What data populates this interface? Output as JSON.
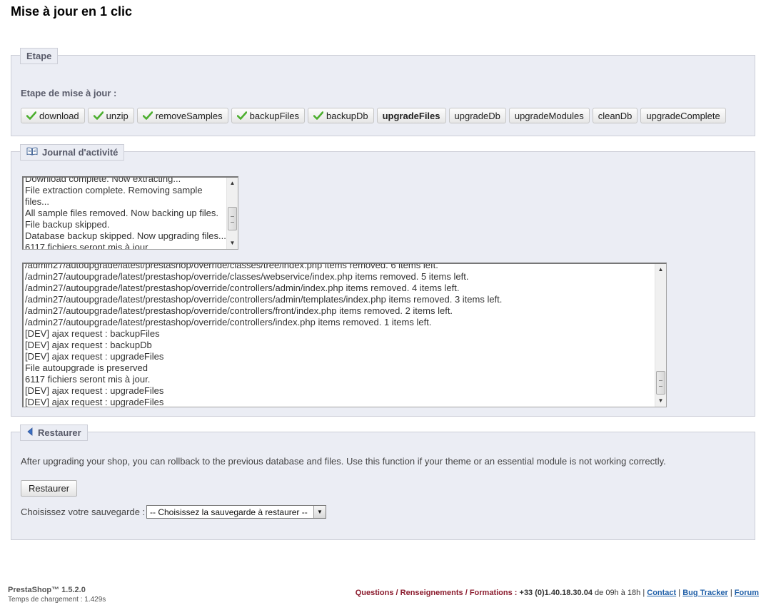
{
  "page": {
    "title": "Mise à jour en 1 clic"
  },
  "etape": {
    "legend": "Etape",
    "steps_label": "Etape de mise à jour :",
    "steps": [
      {
        "label": "download",
        "done": true
      },
      {
        "label": "unzip",
        "done": true
      },
      {
        "label": "removeSamples",
        "done": true
      },
      {
        "label": "backupFiles",
        "done": true
      },
      {
        "label": "backupDb",
        "done": true
      },
      {
        "label": "upgradeFiles",
        "done": false,
        "current": true
      },
      {
        "label": "upgradeDb",
        "done": false
      },
      {
        "label": "upgradeModules",
        "done": false
      },
      {
        "label": "cleanDb",
        "done": false
      },
      {
        "label": "upgradeComplete",
        "done": false
      }
    ]
  },
  "journal": {
    "legend": "Journal d'activité",
    "summary_lines": [
      "Download complete. Now extracting...",
      "File extraction complete. Removing sample files...",
      "All sample files removed. Now backing up files.",
      "File backup skipped.",
      "Database backup skipped. Now upgrading files...",
      "6117 fichiers seront mis à jour."
    ],
    "detail_lines": [
      "/admin27/autoupgrade/latest/prestashop/override/classes/tree/index.php items removed. 6 items left.",
      "/admin27/autoupgrade/latest/prestashop/override/classes/webservice/index.php items removed. 5 items left.",
      "/admin27/autoupgrade/latest/prestashop/override/controllers/admin/index.php items removed. 4 items left.",
      "/admin27/autoupgrade/latest/prestashop/override/controllers/admin/templates/index.php items removed. 3 items left.",
      "/admin27/autoupgrade/latest/prestashop/override/controllers/front/index.php items removed. 2 items left.",
      "/admin27/autoupgrade/latest/prestashop/override/controllers/index.php items removed. 1 items left.",
      "[DEV] ajax request : backupFiles",
      "[DEV] ajax request : backupDb",
      "[DEV] ajax request : upgradeFiles",
      "File autoupgrade is preserved",
      "6117 fichiers seront mis à jour.",
      "[DEV] ajax request : upgradeFiles",
      "[DEV] ajax request : upgradeFiles"
    ]
  },
  "restore": {
    "legend": "Restaurer",
    "description": "After upgrading your shop, you can rollback to the previous database and files. Use this function if your theme or an essential module is not working correctly.",
    "button_label": "Restaurer",
    "backup_label": "Choisissez votre sauvegarde :",
    "backup_selected": "-- Choisissez la sauvegarde à restaurer --"
  },
  "footer": {
    "brand": "PrestaShop™ 1.5.2.0",
    "load_time": "Temps de chargement : 1.429s",
    "questions": "Questions / Renseignements / Formations :",
    "phone": "+33 (0)1.40.18.30.04",
    "hours": "de 09h à 18h",
    "sep": "|",
    "links": [
      "Contact",
      "Bug Tracker",
      "Forum"
    ]
  },
  "colors": {
    "panel_bg": "#ebedf4",
    "panel_border": "#ccced7",
    "legend_text": "#585a69",
    "check_green": "#4caf2e",
    "footer_link": "#1f5fa8",
    "footer_question": "#8b1c2e"
  }
}
